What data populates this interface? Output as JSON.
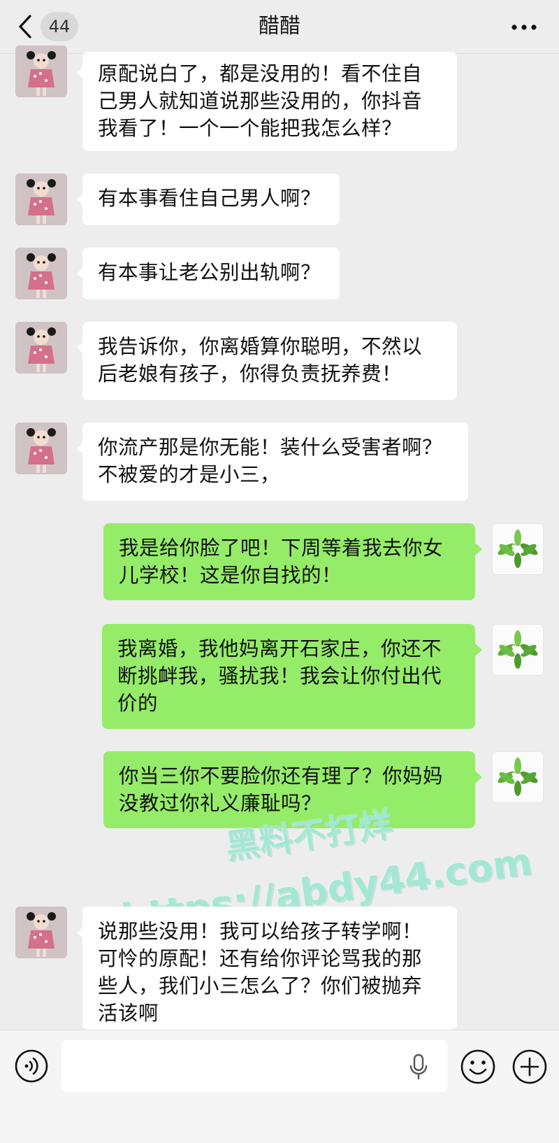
{
  "header": {
    "back_count": "44",
    "title": "醋醋",
    "more_label": "•••"
  },
  "messages": [
    {
      "side": "left",
      "text": "原配说白了，都是没用的！看不住自\n己男人就知道说那些没用的，你抖音\n我看了！一个一个能把我怎么样？"
    },
    {
      "side": "left",
      "text": "有本事看住自己男人啊？"
    },
    {
      "side": "left",
      "text": "有本事让老公别出轨啊？"
    },
    {
      "side": "left",
      "text": "我告诉你，你离婚算你聪明，不然以\n后老娘有孩子，你得负责抚养费！"
    },
    {
      "side": "left",
      "text": "你流产那是你无能！装什么受害者啊？\n不被爱的才是小三，"
    },
    {
      "side": "right",
      "text": "我是给你脸了吧！下周等着我去你女\n儿学校！这是你自找的！"
    },
    {
      "side": "right",
      "text": "我离婚，我他妈离开石家庄，你还不\n断挑衅我，骚扰我！我会让你付出代\n价的"
    },
    {
      "side": "right",
      "text": "你当三你不要脸你还有理了？你妈妈\n没教过你礼义廉耻吗？"
    },
    {
      "side": "left",
      "text": "说那些没用！我可以给孩子转学啊！\n可怜的原配！还有给你评论骂我的那\n些人，我们小三怎么了？你们被抛弃\n活该啊"
    }
  ],
  "watermark": {
    "line1": "黑料不打烊",
    "line2": "https://abdy44.com"
  },
  "input_bar": {
    "placeholder": ""
  },
  "colors": {
    "background": "#ededed",
    "bubble_left": "#ffffff",
    "bubble_right": "#95ec69",
    "watermark": "#8ce1c8"
  },
  "icons": {
    "back": "chevron-left-icon",
    "more": "more-dots-icon",
    "voice": "voice-icon",
    "mic": "microphone-icon",
    "emoji": "emoji-icon",
    "plus": "plus-icon",
    "avatar_left": "cartoon-girl-avatar",
    "avatar_right": "flower-avatar"
  }
}
